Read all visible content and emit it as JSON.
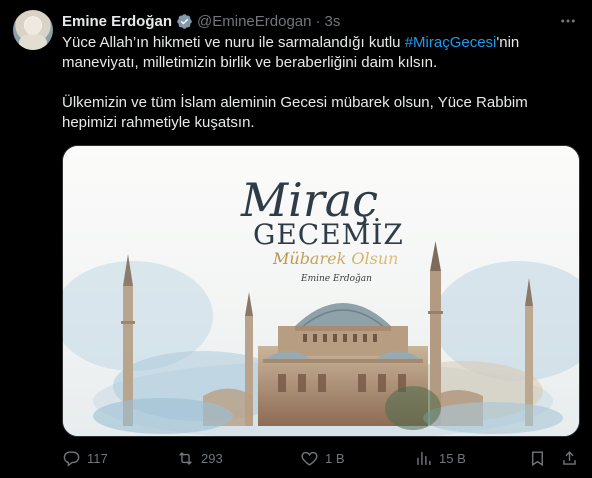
{
  "author": {
    "name": "Emine Erdoğan",
    "handle": "@EmineErdogan",
    "separator": "·",
    "time": "3s"
  },
  "tweet": {
    "line1_before": "Yüce Allah’ın hikmeti ve nuru ile sarmalandığı kutlu ",
    "hashtag": "#MiraçGecesi",
    "line1_after": "'nin maneviyatı, milletimizin birlik ve beraberliğini daim kılsın.",
    "paragraph2": "Ülkemizin ve tüm İslam aleminin Gecesi mübarek olsun, Yüce Rabbim hepimizi rahmetiyle kuşatsın."
  },
  "image": {
    "title_script": "Miraç",
    "title_caps": "GECEMİZ",
    "subtitle": "Mübarek Olsun",
    "signature": "Emine Erdoğan"
  },
  "actions": {
    "replies": "117",
    "reposts": "293",
    "likes": "1 B",
    "views": "15 B"
  },
  "colors": {
    "background": "#000000",
    "text": "#e7e9ea",
    "muted": "#71767b",
    "accent": "#1d9bf0"
  }
}
